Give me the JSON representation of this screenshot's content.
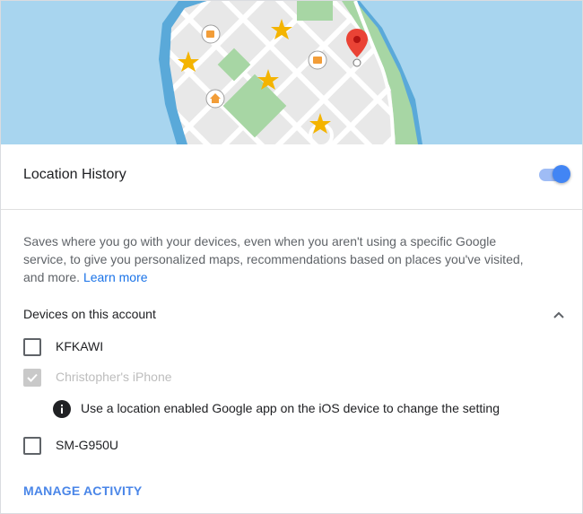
{
  "card": {
    "title": "Location History",
    "toggle_on": true,
    "accent_color": "#4285f4",
    "description": "Saves where you go with your devices, even when you aren't using a specific Google service, to give you personalized maps, recommendations based on places you've visited, and more.",
    "learn_more": "Learn more"
  },
  "devices": {
    "heading": "Devices on this account",
    "expanded": true,
    "items": [
      {
        "name": "KFKAWI",
        "checked": false,
        "disabled": false
      },
      {
        "name": "Christopher's iPhone",
        "checked": true,
        "disabled": true
      },
      {
        "name": "SM-G950U",
        "checked": false,
        "disabled": false
      }
    ],
    "ios_note": "Use a location enabled Google app on the iOS device to change the setting"
  },
  "actions": {
    "manage_activity": "MANAGE ACTIVITY"
  },
  "icons": {
    "map": "map-illustration",
    "toggle": "toggle-switch",
    "chevron": "chevron-up-icon",
    "checkbox": "checkbox-icon",
    "info": "info-icon"
  }
}
